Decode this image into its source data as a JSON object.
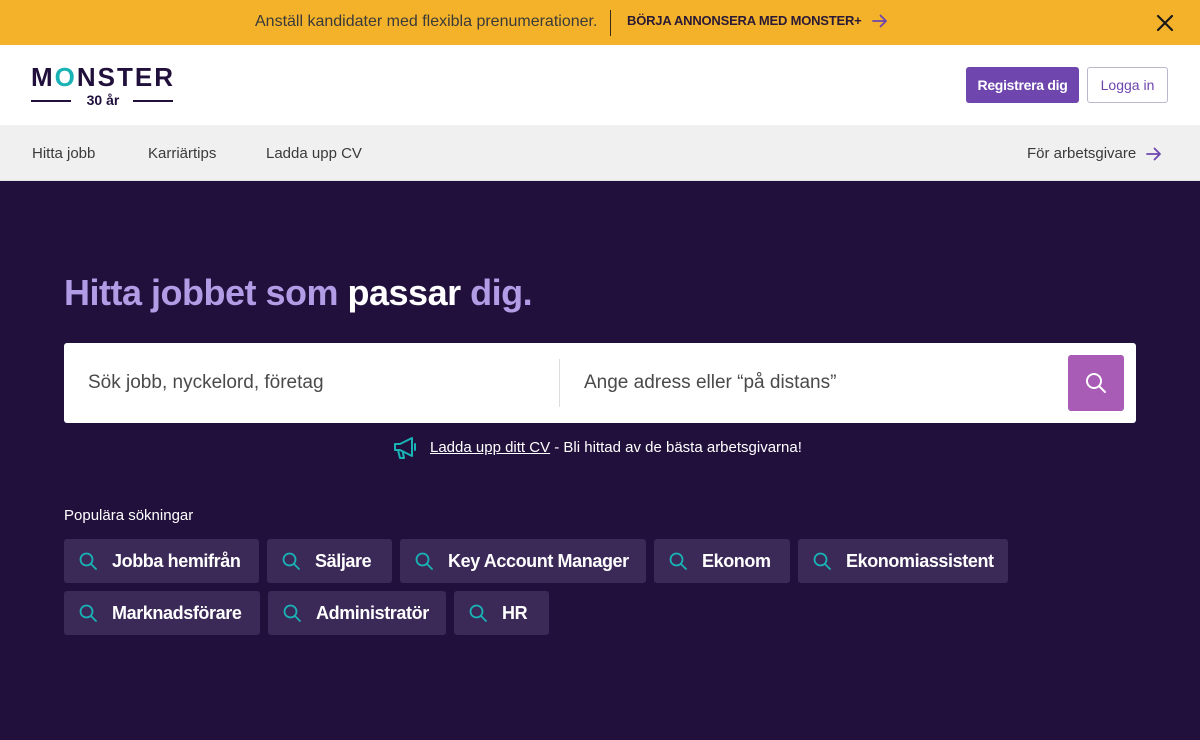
{
  "promo": {
    "text": "Anställ kandidater med flexibla prenumerationer.",
    "cta": "BÖRJA ANNONSERA MED MONSTER+",
    "background": "#f3b229"
  },
  "header": {
    "logo_word_a": "M",
    "logo_word_o": "O",
    "logo_word_b": "NSTER",
    "logo_sub": "30 år",
    "register_label": "Registrera dig",
    "login_label": "Logga in"
  },
  "nav": {
    "items": [
      {
        "label": "Hitta jobb"
      },
      {
        "label": "Karriärtips"
      },
      {
        "label": "Ladda upp CV"
      }
    ],
    "employer_label": "För arbetsgivare"
  },
  "hero": {
    "title_part1": "Hitta jobbet som ",
    "title_part2": "passar",
    "title_part3": " dig.",
    "what_placeholder": "Sök jobb, nyckelord, företag",
    "where_placeholder": "Ange adress eller “på distans”",
    "cv_link": "Ladda upp ditt CV",
    "cv_rest": " - Bli hittad av de bästa arbetsgivarna!",
    "background": "#21103c",
    "accent": "#a85cb5"
  },
  "popular": {
    "label": "Populära sökningar",
    "chips": [
      {
        "label": "Jobba hemifrån"
      },
      {
        "label": "Säljare"
      },
      {
        "label": "Key Account Manager"
      },
      {
        "label": "Ekonom"
      },
      {
        "label": "Ekonomiassistent"
      },
      {
        "label": "Marknadsförare"
      },
      {
        "label": "Administratör"
      },
      {
        "label": "HR"
      }
    ]
  },
  "icons": {
    "promo_arrow": "arrow-right-icon",
    "close": "close-icon",
    "search": "search-icon",
    "megaphone": "megaphone-icon"
  }
}
